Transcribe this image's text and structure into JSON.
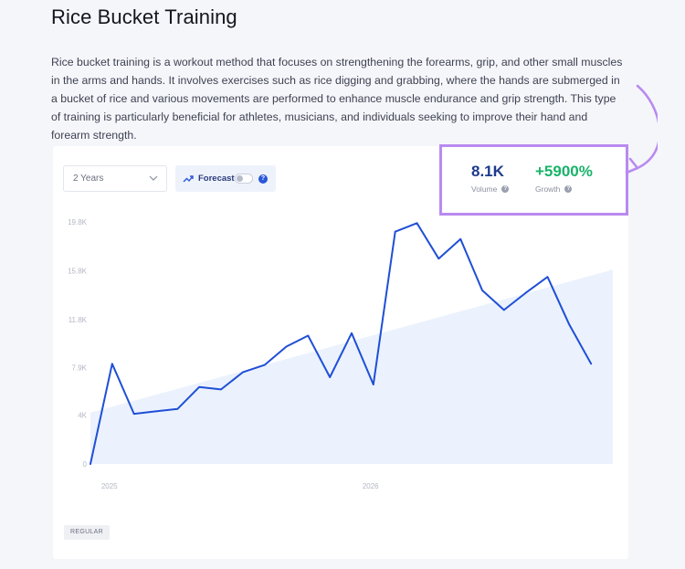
{
  "page": {
    "title": "Rice Bucket Training",
    "description": "Rice bucket training is a workout method that focuses on strengthening the forearms, grip, and other small muscles in the arms and hands. It involves exercises such as rice digging and grabbing, where the hands are submerged in a bucket of rice and various movements are performed to enhance muscle endurance and grip strength. This type of training is particularly beneficial for athletes, musicians, and individuals seeking to improve their hand and forearm strength."
  },
  "controls": {
    "range_value": "2 Years",
    "forecast_label": "Forecast",
    "forecast_enabled": false,
    "help_glyph": "?"
  },
  "metrics": {
    "volume_value": "8.1K",
    "volume_label": "Volume",
    "growth_value": "+5900%",
    "growth_label": "Growth"
  },
  "badge": "REGULAR",
  "colors": {
    "line": "#1f4fd6",
    "area": "#e8f0fd",
    "highlight_box": "#b98af0",
    "arrow": "#b98af0",
    "growth": "#19b36a",
    "volume": "#1d3b8c"
  },
  "icons": [
    "chevron-down-icon",
    "trend-up-icon",
    "question-icon",
    "curved-arrow-icon"
  ],
  "chart_data": {
    "type": "line",
    "title": "",
    "xlabel": "",
    "ylabel": "",
    "y_ticks": [
      0,
      4000,
      7900,
      11800,
      15800,
      19800
    ],
    "y_tick_labels": [
      "0",
      "4K",
      "7.9K",
      "11.8K",
      "15.8K",
      "19.8K"
    ],
    "ylim": [
      0,
      19800
    ],
    "x_ticks": [
      1,
      13
    ],
    "x_tick_labels": [
      "2025",
      "2026"
    ],
    "xlim": [
      0,
      24
    ],
    "grid": false,
    "series": [
      {
        "values": [
          {
            "x": 0,
            "y": 0
          },
          {
            "x": 1,
            "y": 8200
          },
          {
            "x": 2,
            "y": 4100
          },
          {
            "x": 3,
            "y": 4300
          },
          {
            "x": 4,
            "y": 4500
          },
          {
            "x": 5,
            "y": 6300
          },
          {
            "x": 6,
            "y": 6100
          },
          {
            "x": 7,
            "y": 7500
          },
          {
            "x": 8,
            "y": 8100
          },
          {
            "x": 9,
            "y": 9600
          },
          {
            "x": 10,
            "y": 10500
          },
          {
            "x": 11,
            "y": 7100
          },
          {
            "x": 12,
            "y": 10700
          },
          {
            "x": 13,
            "y": 6500
          },
          {
            "x": 14,
            "y": 19000
          },
          {
            "x": 15,
            "y": 19700
          },
          {
            "x": 16,
            "y": 16800
          },
          {
            "x": 17,
            "y": 18400
          },
          {
            "x": 18,
            "y": 14200
          },
          {
            "x": 19,
            "y": 12600
          },
          {
            "x": 20,
            "y": 14000
          },
          {
            "x": 21,
            "y": 15300
          },
          {
            "x": 22,
            "y": 11400
          },
          {
            "x": 23,
            "y": 8200
          }
        ]
      }
    ],
    "trend_area": {
      "start": 4200,
      "end": 15900
    }
  }
}
